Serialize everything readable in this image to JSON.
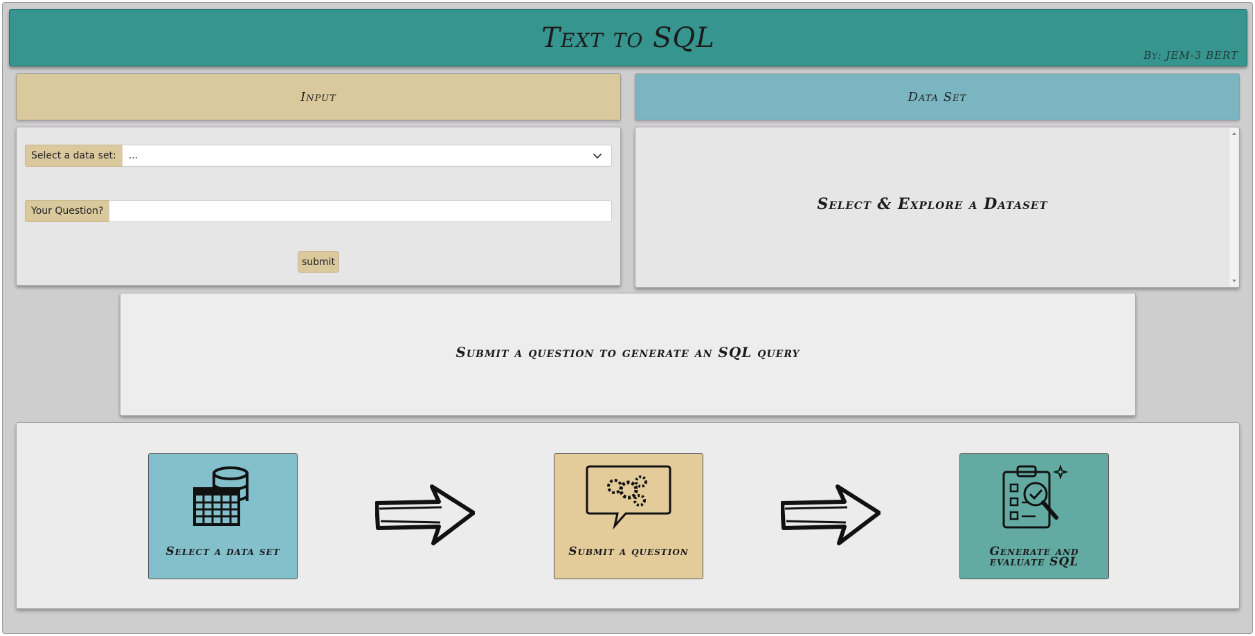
{
  "header": {
    "title": "Text to SQL",
    "byline": "By: JEM-3 BERT",
    "color": "#37958f"
  },
  "tabs": {
    "input_label": "Input",
    "dataset_label": "Data Set",
    "input_color": "#dbc99e",
    "dataset_color": "#7ab5c1"
  },
  "input_panel": {
    "dataset_select": {
      "label": "Select a data set:",
      "value": "..."
    },
    "question": {
      "label": "Your Question?",
      "value": ""
    },
    "submit_label": "submit"
  },
  "dataset_panel": {
    "message": "Select & Explore a Dataset"
  },
  "query_panel": {
    "message": "Submit a question to generate an SQL query"
  },
  "steps": [
    {
      "label": "Select a data set",
      "icon": "database-table-icon",
      "color": "#84c0cb"
    },
    {
      "label": "Submit a question",
      "icon": "speech-bubble-gears-icon",
      "color": "#e4cc9a"
    },
    {
      "label": "Generate and evaluate SQL",
      "icon": "clipboard-magnifier-icon",
      "color": "#62aaa2"
    }
  ]
}
